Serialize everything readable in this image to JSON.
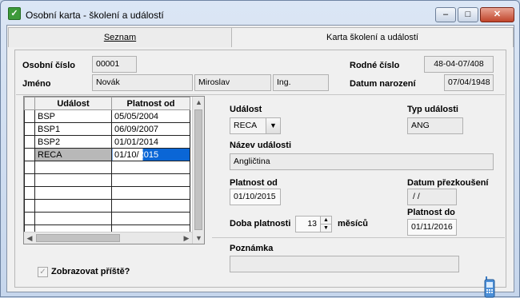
{
  "window": {
    "title": "Osobní karta - školení a událostí",
    "min_glyph": "–",
    "max_glyph": "□",
    "close_glyph": "✕"
  },
  "tabs": [
    {
      "label": "Seznam"
    },
    {
      "label": "Karta školení a událostí"
    }
  ],
  "header": {
    "personal_number_label": "Osobní číslo",
    "personal_number": "00001",
    "name_label": "Jméno",
    "last_name": "Novák",
    "first_name": "Miroslav",
    "title": "Ing.",
    "birth_number_label": "Rodné číslo",
    "birth_number": "48-04-07/408",
    "birth_date_label": "Datum narození",
    "birth_date": "07/04/1948"
  },
  "grid": {
    "columns": [
      "Událost",
      "Platnost od"
    ],
    "rows": [
      {
        "event": "BSP",
        "valid_from": "05/05/2004"
      },
      {
        "event": "BSP1",
        "valid_from": "06/09/2007"
      },
      {
        "event": "BSP2",
        "valid_from": "01/01/2014"
      },
      {
        "event": "RECA",
        "valid_from_a": "01/10/",
        "valid_from_b": "2015"
      }
    ],
    "selected_row": 3
  },
  "detail": {
    "event_label": "Událost",
    "event_value": "RECA",
    "event_type_label": "Typ události",
    "event_type_value": "ANG",
    "event_name_label": "Název události",
    "event_name_value": "Angličtina",
    "valid_from_label": "Platnost od",
    "valid_from_value": "01/10/2015",
    "retest_date_label": "Datum přezkoušení",
    "retest_date_value": "/ /",
    "validity_period_label": "Doba platnosti",
    "validity_period_value": "13",
    "months_label": "měsíců",
    "valid_to_label": "Platnost do",
    "valid_to_value": "01/11/2016",
    "note_label": "Poznámka",
    "note_value": ""
  },
  "footer": {
    "show_next_time_label": "Zobrazovat příště?",
    "show_next_time_checked": true
  },
  "icons": {
    "app": "app-icon",
    "phone": "mobile-phone-icon"
  }
}
